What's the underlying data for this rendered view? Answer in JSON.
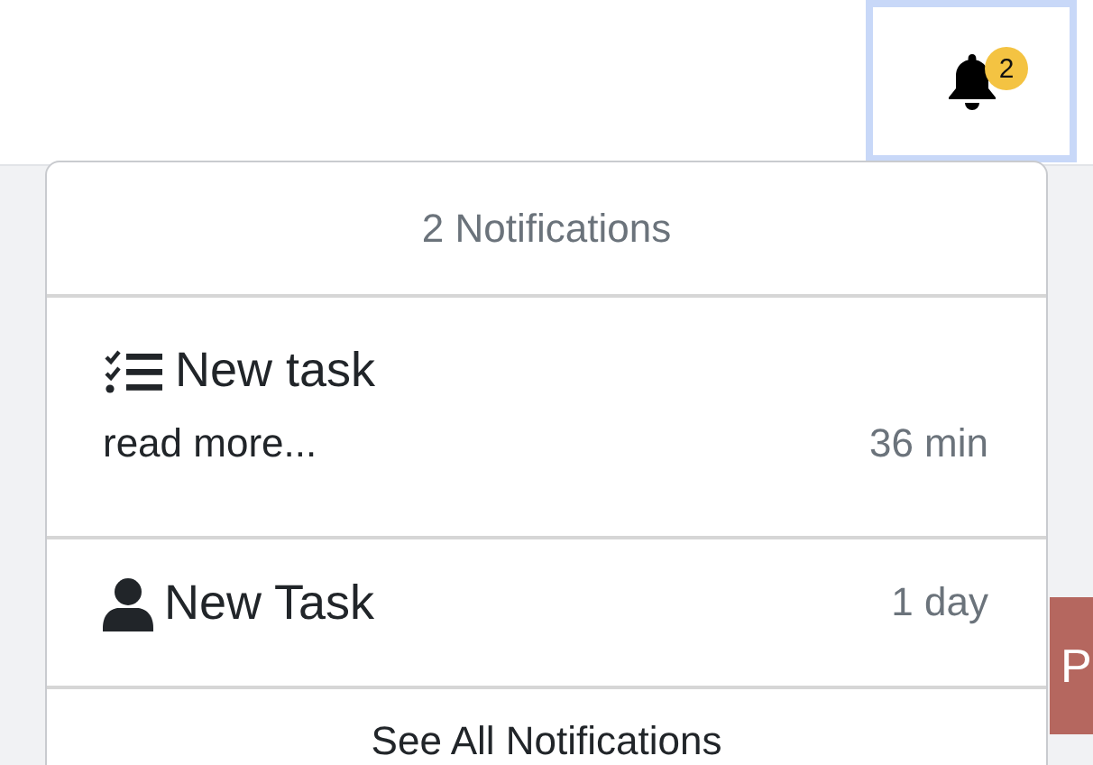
{
  "topbar": {
    "bell": {
      "badge": "2"
    }
  },
  "notifications": {
    "header": "2 Notifications",
    "items": [
      {
        "kind": "task",
        "title": "New task",
        "detail": "read more...",
        "time": "36 min"
      },
      {
        "kind": "user",
        "title": "New Task",
        "time": "1 day"
      }
    ],
    "footer": "See All Notifications"
  },
  "page_button": {
    "label": "P"
  }
}
